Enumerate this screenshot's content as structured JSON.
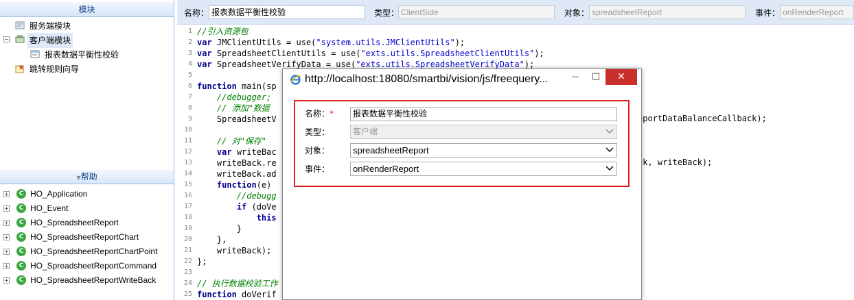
{
  "left_panel": {
    "modules_header": "模块",
    "tree": [
      {
        "label": "服务端模块"
      },
      {
        "label": "客户端模块"
      },
      {
        "label": "报表数据平衡性校验"
      },
      {
        "label": "跳转规则向导"
      }
    ],
    "help_header": "帮助",
    "help_items": [
      {
        "label": "HO_Application"
      },
      {
        "label": "HO_Event"
      },
      {
        "label": "HO_SpreadsheetReport"
      },
      {
        "label": "HO_SpreadsheetReportChart"
      },
      {
        "label": "HO_SpreadsheetReportChartPoint"
      },
      {
        "label": "HO_SpreadsheetReportCommand"
      },
      {
        "label": "HO_SpreadsheetReportWriteBack"
      }
    ]
  },
  "topbar": {
    "name_label": "名称：",
    "name_value": "报表数据平衡性校验",
    "type_label": "类型：",
    "type_value": "ClientSide",
    "object_label": "对象：",
    "object_value": "spreadsheetReport",
    "event_label": "事件：",
    "event_value": "onRenderReport"
  },
  "editor": {
    "lines": [
      {
        "n": "1",
        "code": "//引入资源包"
      },
      {
        "n": "2",
        "code": "var JMClientUtils = use(\"system.utils.JMClientUtils\");"
      },
      {
        "n": "3",
        "code": "var SpreadsheetClientUtils = use(\"exts.utils.SpreadsheetClientUtils\");"
      },
      {
        "n": "4",
        "code": "var SpreadsheetVerifyData = use(\"exts.utils.SpreadsheetVerifyData\");"
      },
      {
        "n": "5",
        "code": ""
      },
      {
        "n": "6",
        "code": "function main(sp"
      },
      {
        "n": "7",
        "code": "    //debugger;"
      },
      {
        "n": "8",
        "code": "    // 添加\"数据"
      },
      {
        "n": "9",
        "code": "    SpreadsheetV"
      },
      {
        "n": "10",
        "code": ""
      },
      {
        "n": "11",
        "code": "    // 对\"保存\""
      },
      {
        "n": "12",
        "code": "    var writeBac"
      },
      {
        "n": "13",
        "code": "    writeBack.re"
      },
      {
        "n": "14",
        "code": "    writeBack.ad"
      },
      {
        "n": "15",
        "code": "    function(e) "
      },
      {
        "n": "16",
        "code": "        //debugg"
      },
      {
        "n": "17",
        "code": "        if (doVe"
      },
      {
        "n": "18",
        "code": "            this"
      },
      {
        "n": "19",
        "code": "        }"
      },
      {
        "n": "20",
        "code": "    },"
      },
      {
        "n": "21",
        "code": "    writeBack);"
      },
      {
        "n": "22",
        "code": "};"
      },
      {
        "n": "23",
        "code": ""
      },
      {
        "n": "24",
        "code": "// 执行数据校验工作"
      },
      {
        "n": "25",
        "code": "function doVerif"
      }
    ],
    "right_fragments": {
      "line9": "eportDataBalanceCallback);",
      "line13": "ck, writeBack);"
    }
  },
  "dialog": {
    "title": "http://localhost:18080/smartbi/vision/js/freequery...",
    "minimize_glyph": "—",
    "maximize_glyph": "□",
    "close_glyph": "✕",
    "form": {
      "name_label": "名称：",
      "required_mark": "*",
      "name_value": "报表数据平衡性校验",
      "type_label": "类型：",
      "type_value": "客户端",
      "object_label": "对象：",
      "object_value": "spreadsheetReport",
      "event_label": "事件：",
      "event_value": "onRenderReport"
    }
  },
  "colors": {
    "panel_header_text": "#15428b",
    "dialog_close_bg": "#c9302c",
    "form_border": "#e02020",
    "help_icon": "#3aa640"
  }
}
